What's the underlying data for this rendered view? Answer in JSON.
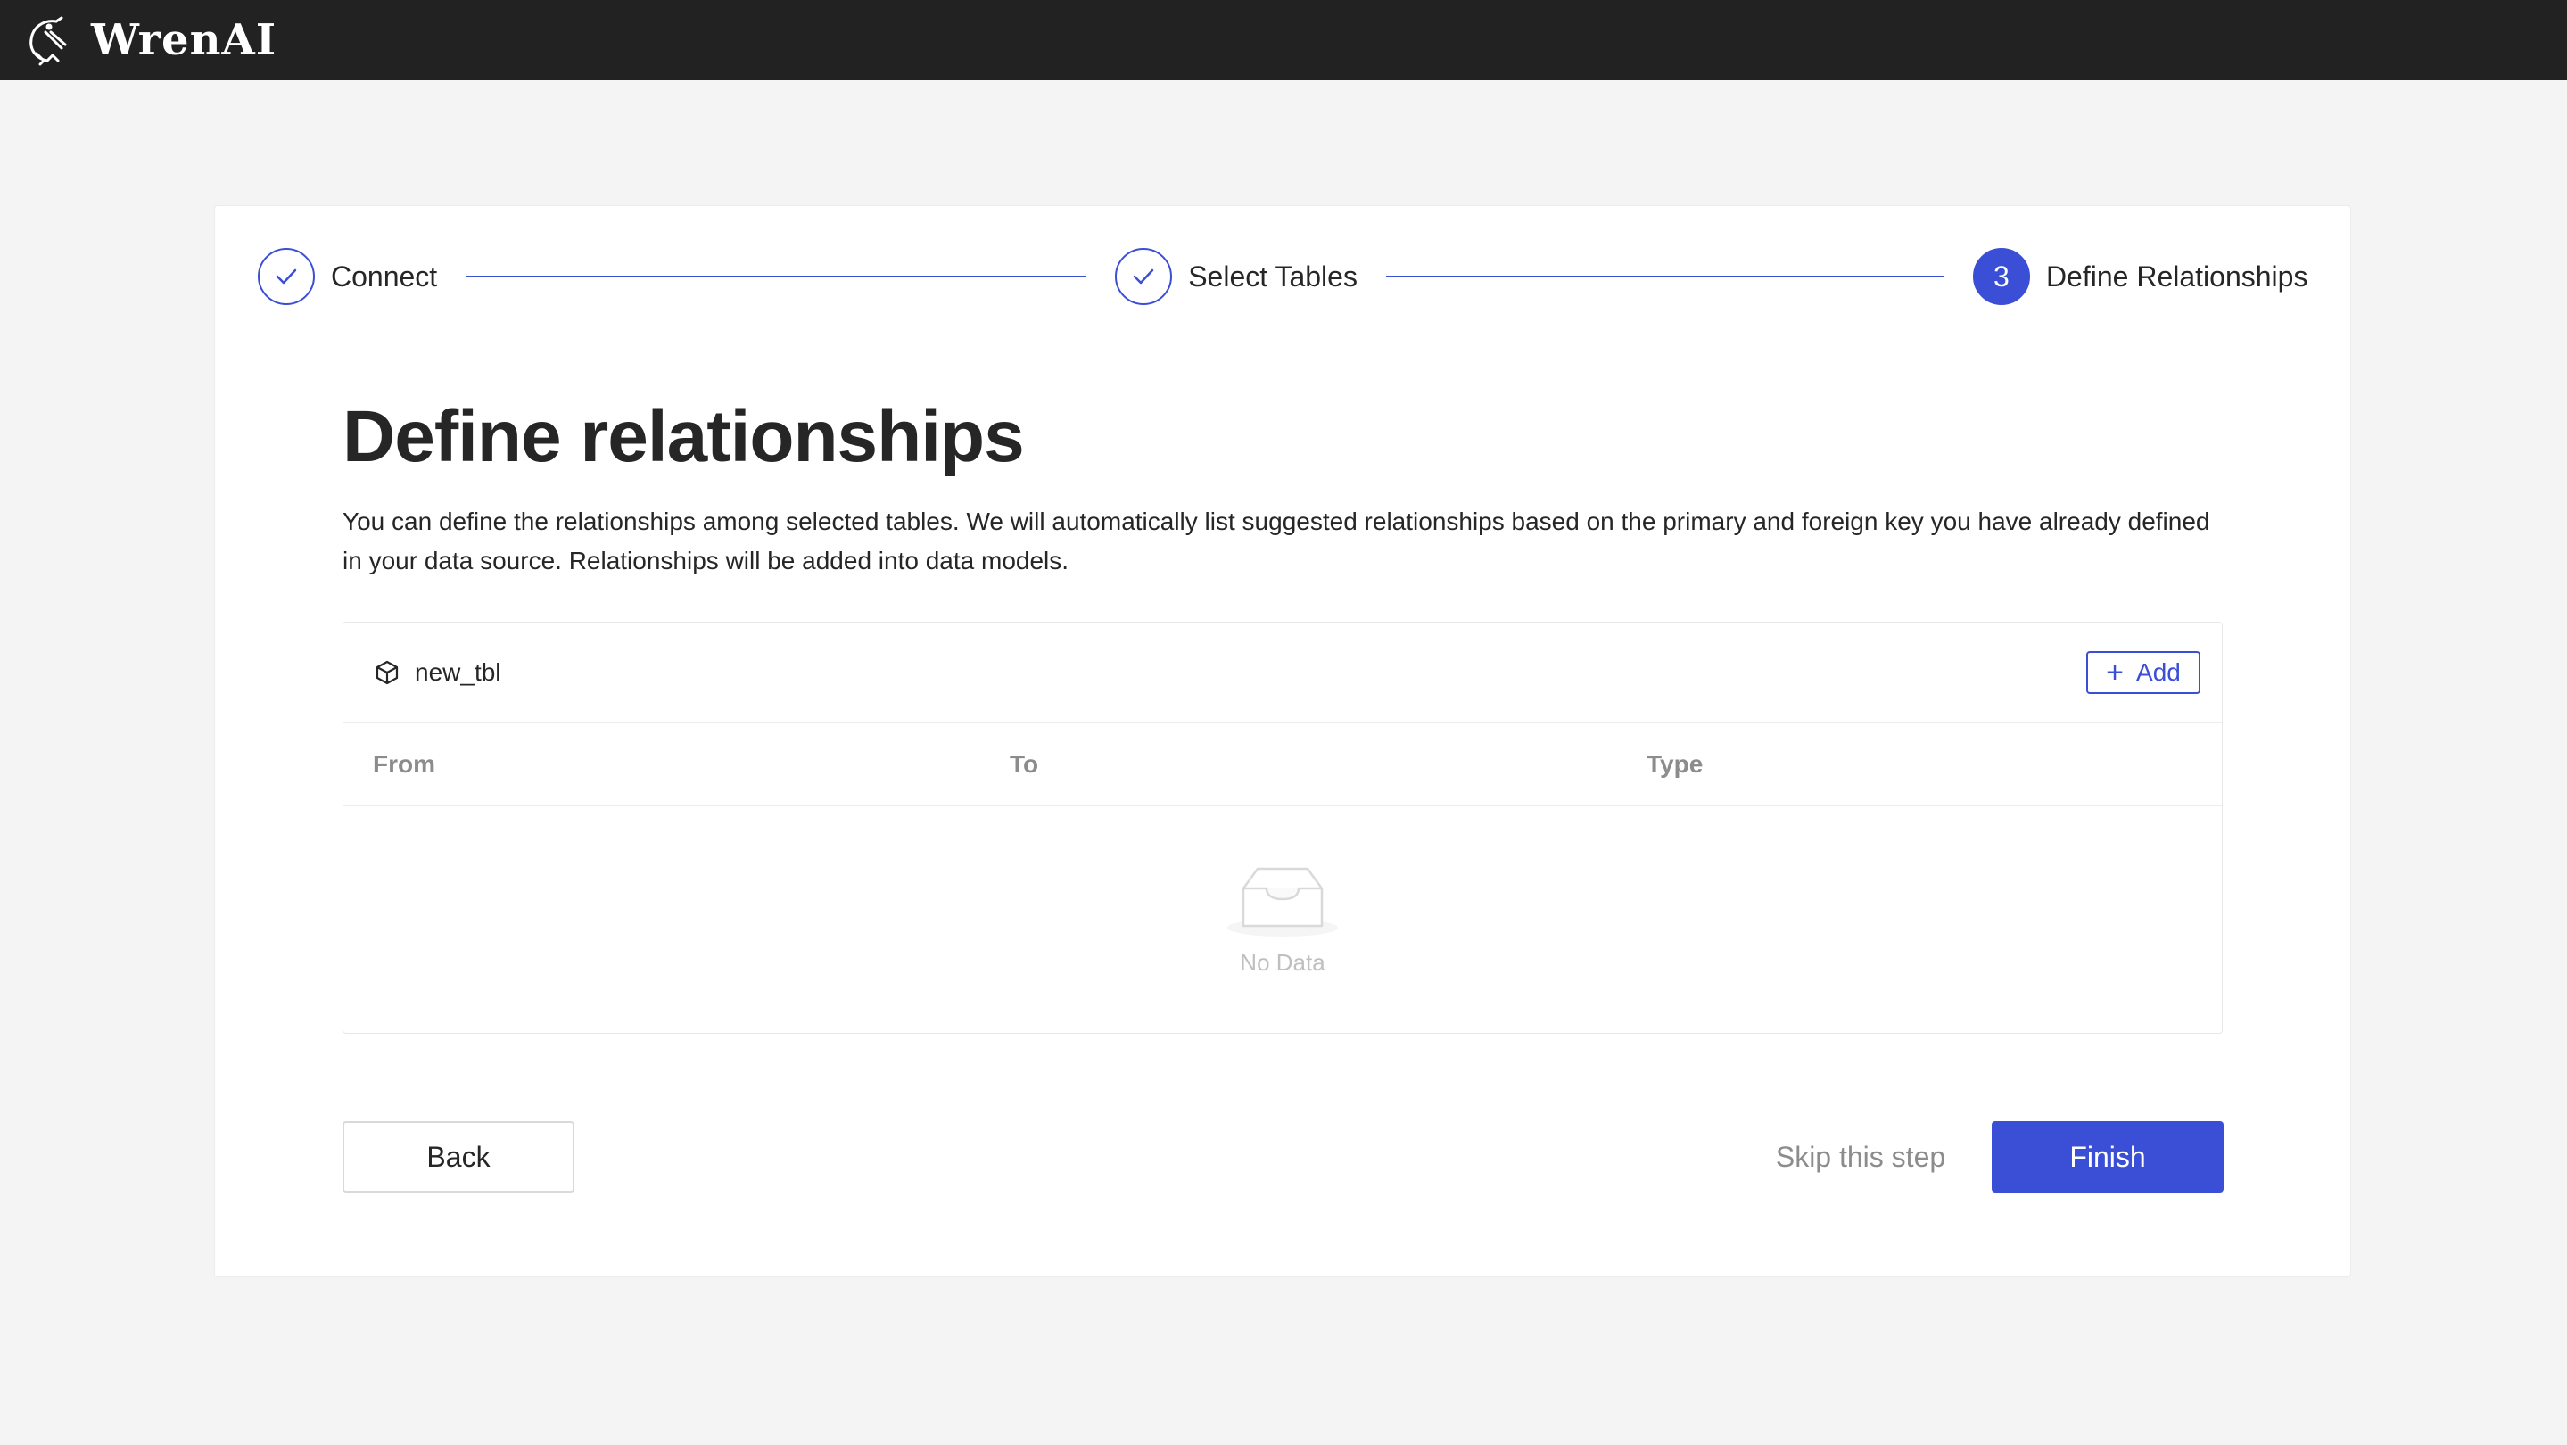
{
  "app": {
    "name": "WrenAI"
  },
  "steps": [
    {
      "label": "Connect",
      "status": "done"
    },
    {
      "label": "Select Tables",
      "status": "done"
    },
    {
      "label": "Define Relationships",
      "status": "active",
      "number": "3"
    }
  ],
  "page": {
    "title": "Define relationships",
    "description": "You can define the relationships among selected tables. We will automatically list suggested relationships based on the primary and foreign key you have already defined in your data source. Relationships will be added into data models."
  },
  "panel": {
    "table_name": "new_tbl",
    "add_label": "Add",
    "columns": [
      "From",
      "To",
      "Type"
    ],
    "empty_text": "No Data"
  },
  "actions": {
    "back_label": "Back",
    "skip_label": "Skip this step",
    "finish_label": "Finish"
  },
  "colors": {
    "accent": "#3b4fd6",
    "topbar": "#222222",
    "background": "#f4f4f4"
  },
  "icons": {
    "logo": "wren-bird-icon",
    "step_done": "check-icon",
    "table": "cube-icon",
    "add": "plus-icon",
    "empty": "inbox-icon"
  }
}
